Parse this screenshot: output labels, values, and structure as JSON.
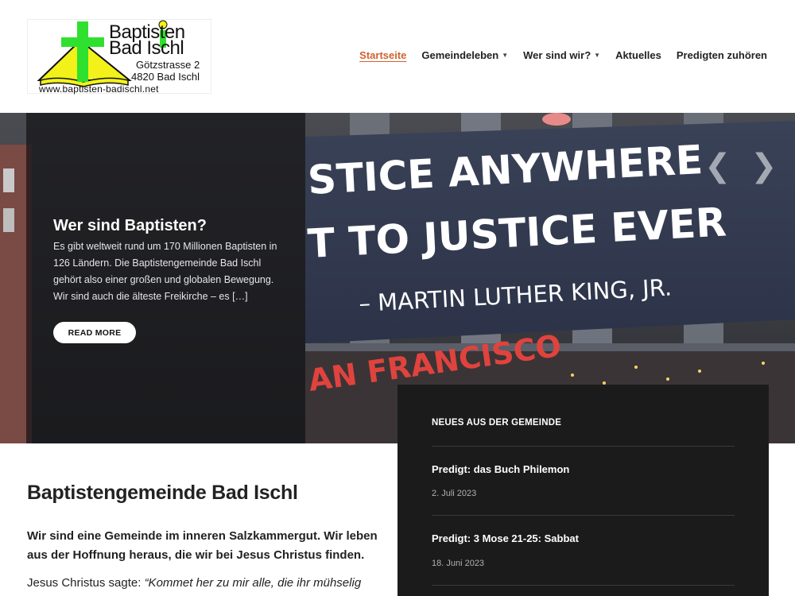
{
  "logo": {
    "line1": "Baptisten",
    "line2": "Bad Ischl",
    "address_street": "Götzstrasse 2",
    "address_city": "4820 Bad Ischl",
    "url": "www.baptisten-badischl.net"
  },
  "nav": {
    "items": [
      {
        "label": "Startseite",
        "active": true,
        "has_dropdown": false
      },
      {
        "label": "Gemeindeleben",
        "active": false,
        "has_dropdown": true
      },
      {
        "label": "Wer sind wir?",
        "active": false,
        "has_dropdown": true
      },
      {
        "label": "Aktuelles",
        "active": false,
        "has_dropdown": false
      },
      {
        "label": "Predigten zuhören",
        "active": false,
        "has_dropdown": false
      }
    ],
    "dropdown_icon": "chevron-down-icon"
  },
  "hero": {
    "title": "Wer sind Baptisten?",
    "text": "Es gibt weltweit rund um 170 Millionen Baptisten in 126 Ländern. Die Baptistengemeinde Bad Ischl gehört also einer großen und globalen Bewegung. Wir sind auch die älteste Freikirche – es […]",
    "button_label": "READ MORE",
    "banner_line1": "STICE ANYWHERE",
    "banner_line2": "T TO JUSTICE EVER",
    "banner_line3": "– MARTIN LUTHER KING, JR.",
    "sign_text": "AN FRANCISCO",
    "prev_icon": "chevron-left-icon",
    "next_icon": "chevron-right-icon"
  },
  "main": {
    "title": "Baptistengemeinde Bad Ischl",
    "intro": "Wir sind eine Gemeinde im inneren Salzkammergut. Wir leben aus der Hoffnung heraus, die wir bei Jesus Christus finden.",
    "quote_prefix": "Jesus Christus sagte: ",
    "quote_text": "“Kommet her zu mir alle, die ihr mühselig"
  },
  "news": {
    "heading": "NEUES AUS DER GEMEINDE",
    "items": [
      {
        "title": "Predigt: das Buch Philemon",
        "date": "2. Juli 2023"
      },
      {
        "title": "Predigt: 3 Mose 21-25: Sabbat",
        "date": "18. Juni 2023"
      }
    ]
  },
  "colors": {
    "accent": "#d2622f",
    "news_bg": "#1b1b1b",
    "logo_green": "#2fe02f",
    "logo_yellow": "#f2f21a"
  }
}
